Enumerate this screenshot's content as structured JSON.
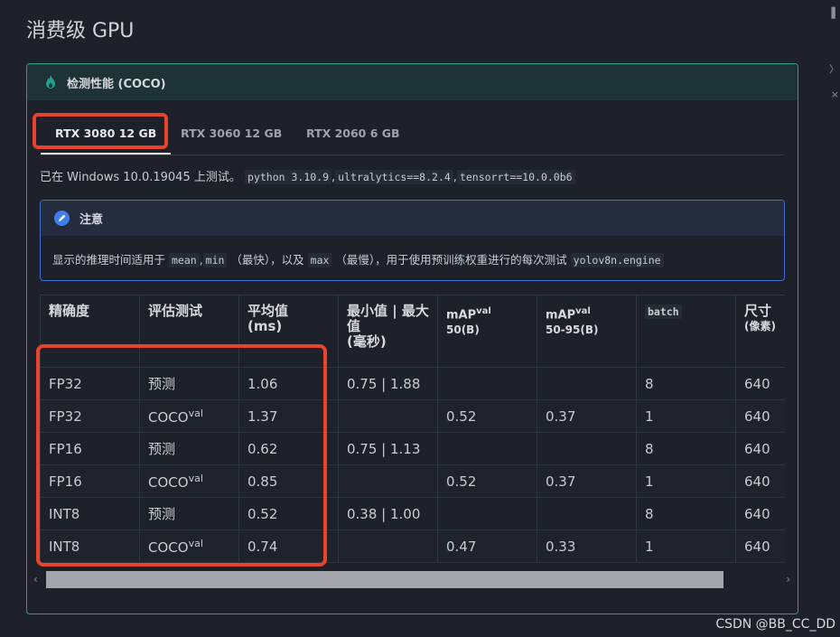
{
  "page": {
    "title": "消费级 GPU",
    "watermark": "CSDN @BB_CC_DD"
  },
  "admonition": {
    "title": "检测性能 (COCO)",
    "icon": "flame-icon",
    "accent": "#1fa38a"
  },
  "tabs": [
    {
      "label": "RTX 3080 12 GB",
      "active": true
    },
    {
      "label": "RTX 3060 12 GB",
      "active": false
    },
    {
      "label": "RTX 2060 6 GB",
      "active": false
    }
  ],
  "env": {
    "prefix": "已在 Windows 10.0.19045 上测试。",
    "code1": "python 3.10.9",
    "sep1": ",",
    "code2": "ultralytics==8.2.4",
    "sep2": ",",
    "code3": "tensorrt==10.0.0b6"
  },
  "note": {
    "title": "注意",
    "icon": "pencil-icon",
    "text1": "显示的推理时间适用于 ",
    "code_mean": "mean",
    "comma": ",",
    "code_min": "min",
    "text2": " （最快），以及 ",
    "code_max": "max",
    "text3": " （最慢），用于使用预训练权重进行的每次测试 ",
    "code_engine": "yolov8n.engine"
  },
  "table": {
    "headers": {
      "precision": "精确度",
      "eval": "评估测试",
      "mean_main": "平均值",
      "mean_sub": "(ms)",
      "minmax_main": "最小值 | 最大值",
      "minmax_sub": "(毫秒)",
      "map50_main": "mAP",
      "map50_sup": "val",
      "map50_sub": "50(B)",
      "map5095_main": "mAP",
      "map5095_sup": "val",
      "map5095_sub": "50-95(B)",
      "batch": "batch",
      "size_main": "尺寸",
      "size_sub": "(像素)"
    },
    "rows": [
      {
        "precision": "FP32",
        "eval": "预测",
        "eval_sup": "",
        "mean": "1.06",
        "minmax": "0.75 | 1.88",
        "map50": "",
        "map5095": "",
        "batch": "8",
        "size": "640"
      },
      {
        "precision": "FP32",
        "eval": "COCO",
        "eval_sup": "val",
        "mean": "1.37",
        "minmax": "",
        "map50": "0.52",
        "map5095": "0.37",
        "batch": "1",
        "size": "640"
      },
      {
        "precision": "FP16",
        "eval": "预测",
        "eval_sup": "",
        "mean": "0.62",
        "minmax": "0.75 | 1.13",
        "map50": "",
        "map5095": "",
        "batch": "8",
        "size": "640"
      },
      {
        "precision": "FP16",
        "eval": "COCO",
        "eval_sup": "val",
        "mean": "0.85",
        "minmax": "",
        "map50": "0.52",
        "map5095": "0.37",
        "batch": "1",
        "size": "640"
      },
      {
        "precision": "INT8",
        "eval": "预测",
        "eval_sup": "",
        "mean": "0.52",
        "minmax": "0.38 | 1.00",
        "map50": "",
        "map5095": "",
        "batch": "8",
        "size": "640"
      },
      {
        "precision": "INT8",
        "eval": "COCO",
        "eval_sup": "val",
        "mean": "0.74",
        "minmax": "",
        "map50": "0.47",
        "map5095": "0.33",
        "batch": "1",
        "size": "640"
      }
    ]
  },
  "scrollbar": {
    "left": "‹",
    "right": "›"
  },
  "colors": {
    "highlight": "#e8432d",
    "note_border": "#3f6fd6"
  }
}
